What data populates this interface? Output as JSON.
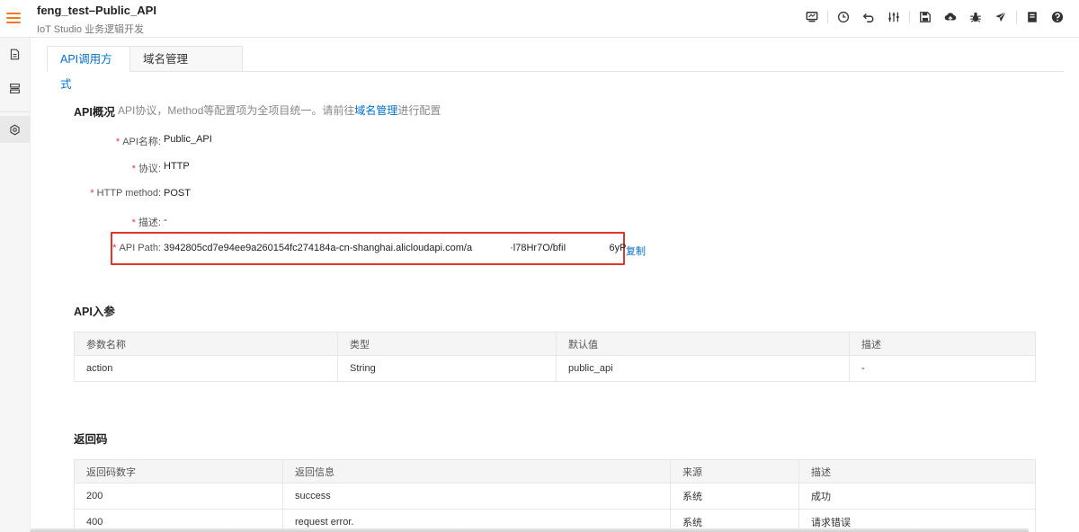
{
  "header": {
    "title": "feng_test–Public_API",
    "subtitle": "IoT Studio 业务逻辑开发",
    "toolbar_icons": [
      "monitor-icon",
      "clock-icon",
      "undo-icon",
      "sliders-icon",
      "save-icon",
      "cloud-upload-icon",
      "bug-icon",
      "send-icon",
      "document-icon",
      "help-icon"
    ]
  },
  "rail": {
    "items": [
      "file-icon",
      "list-icon",
      "settings-icon"
    ]
  },
  "tabs": [
    {
      "label": "API调用方式"
    },
    {
      "label": "域名管理"
    }
  ],
  "overview": {
    "title": "API概况",
    "note_prefix": "API协议，Method等配置项为全项目统一。请前往",
    "note_link": "域名管理",
    "note_suffix": "进行配置",
    "fields": {
      "name_label": "API名称:",
      "name_value": "Public_API",
      "protocol_label": "协议:",
      "protocol_value": "HTTP",
      "method_label": "HTTP method:",
      "method_value": "POST",
      "desc_label": "描述:",
      "desc_value": "-",
      "path_label": "API Path:",
      "path_part1": "3942805cd7e94ee9a260154fc274184a-cn-shanghai.alicloudapi.com/a",
      "path_part2": "·l78Hr7O/bfiI",
      "path_part3": "6yP",
      "copy_label": "复制"
    }
  },
  "params": {
    "title": "API入参",
    "columns": [
      "参数名称",
      "类型",
      "默认值",
      "描述"
    ],
    "rows": [
      [
        "action",
        "String",
        "public_api",
        "-"
      ]
    ]
  },
  "codes": {
    "title": "返回码",
    "columns": [
      "返回码数字",
      "返回信息",
      "来源",
      "描述"
    ],
    "rows": [
      [
        "200",
        "success",
        "系统",
        "成功"
      ],
      [
        "400",
        "request error.",
        "系统",
        "请求错误"
      ]
    ]
  },
  "colors": {
    "accent": "#0070cc",
    "required": "#e4393c",
    "highlight_border": "#e1362c",
    "menu": "#f5781e"
  }
}
